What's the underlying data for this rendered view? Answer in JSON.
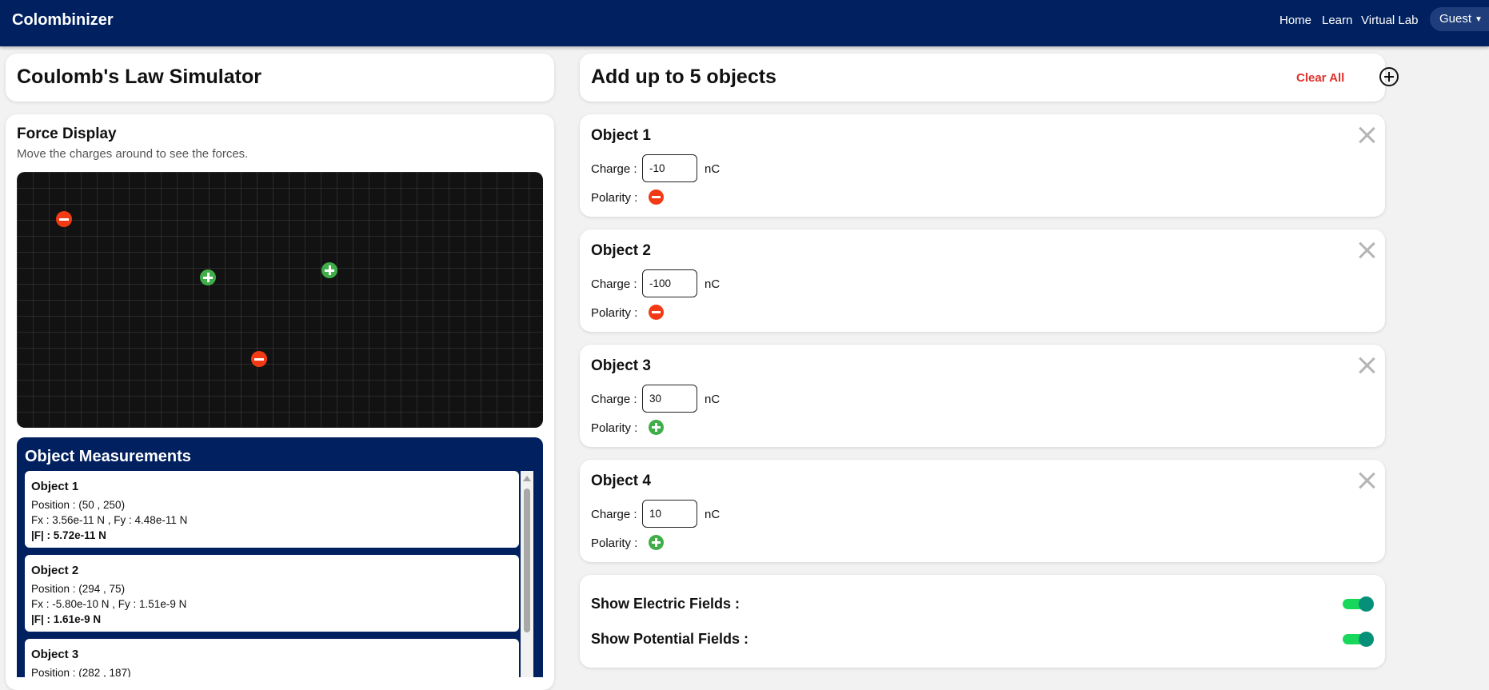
{
  "nav": {
    "brand": "Colombinizer",
    "links": [
      "Home",
      "Learn",
      "Virtual Lab"
    ],
    "user": "Guest"
  },
  "left": {
    "title": "Coulomb's Law Simulator",
    "force_display": {
      "title": "Force Display",
      "subtitle": "Move the charges around to see the forces."
    },
    "measurements": {
      "title": "Object Measurements",
      "items": [
        {
          "name": "Object 1",
          "position": "Position : (50 , 250)",
          "components": "Fx : 3.56e-11 N , Fy : 4.48e-11 N",
          "magnitude": "|F| : 5.72e-11 N"
        },
        {
          "name": "Object 2",
          "position": "Position : (294 , 75)",
          "components": "Fx : -5.80e-10 N , Fy : 1.51e-9 N",
          "magnitude": "|F| : 1.61e-9 N"
        },
        {
          "name": "Object 3",
          "position": "Position : (282 , 187)",
          "components": "",
          "magnitude": ""
        }
      ]
    }
  },
  "right": {
    "title": "Add up to 5 objects",
    "clear_all": "Clear All",
    "objects": [
      {
        "name": "Object 1",
        "charge_label": "Charge :",
        "charge": "-10",
        "unit": "nC",
        "polarity_label": "Polarity :",
        "polarity": "negative"
      },
      {
        "name": "Object 2",
        "charge_label": "Charge :",
        "charge": "-100",
        "unit": "nC",
        "polarity_label": "Polarity :",
        "polarity": "negative"
      },
      {
        "name": "Object 3",
        "charge_label": "Charge :",
        "charge": "30",
        "unit": "nC",
        "polarity_label": "Polarity :",
        "polarity": "positive"
      },
      {
        "name": "Object 4",
        "charge_label": "Charge :",
        "charge": "10",
        "unit": "nC",
        "polarity_label": "Polarity :",
        "polarity": "positive"
      }
    ],
    "toggles": {
      "electric_fields": {
        "label": "Show Electric Fields :",
        "on": true
      },
      "potential_fields": {
        "label": "Show Potential Fields :",
        "on": true
      }
    }
  },
  "colors": {
    "navbar": "#00205f",
    "negative": "#f23a14",
    "positive": "#3fae48",
    "clear_all": "#e0302b",
    "toggle_track": "#17d85a",
    "toggle_knob": "#06907a"
  }
}
